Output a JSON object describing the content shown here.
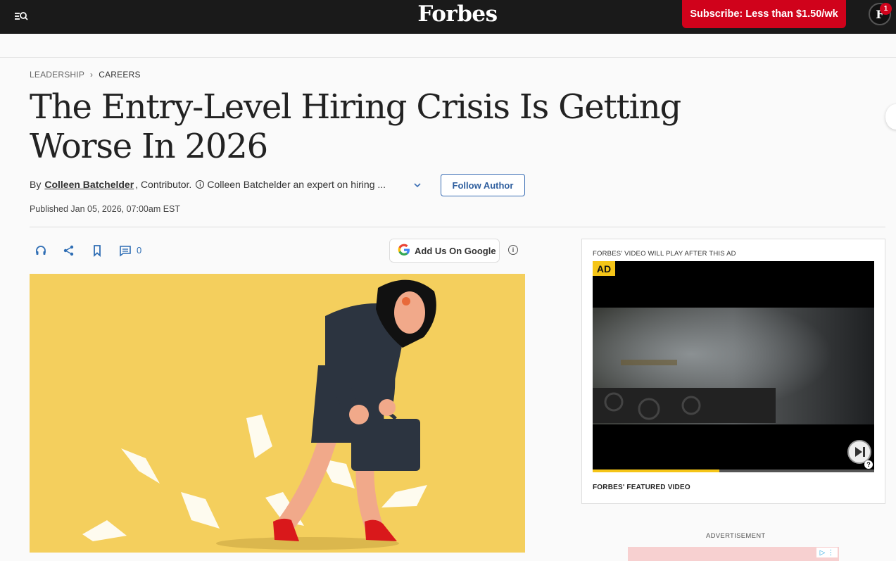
{
  "header": {
    "logo": "Forbes",
    "subscribe_label": "Subscribe: Less than $1.50/wk",
    "account_initial": "F",
    "notification_count": "1"
  },
  "breadcrumb": [
    "LEADERSHIP",
    "CAREERS"
  ],
  "article": {
    "headline": "The Entry-Level Hiring Crisis Is Getting Worse In 2026",
    "by_prefix": "By",
    "author": "Colleen Batchelder",
    "role": ", Contributor.",
    "author_bio": "Colleen Batchelder an expert on hiring ...",
    "follow_label": "Follow Author",
    "published": "Published Jan 05, 2026, 07:00am EST",
    "comment_count": "0",
    "google_button_label": "Add Us On Google"
  },
  "video": {
    "caption": "FORBES' VIDEO WILL PLAY AFTER THIS AD",
    "ad_tag": "AD",
    "progress": 0.45,
    "featured_label": "FORBES' FEATURED VIDEO"
  },
  "advertisement_label": "ADVERTISEMENT",
  "colors": {
    "topbar": "#1a1a1a",
    "subscribe": "#d0021b",
    "accent_blue": "#2e6db4",
    "hero_bg": "#f4cf5d",
    "ad_yellow": "#f5c518"
  }
}
